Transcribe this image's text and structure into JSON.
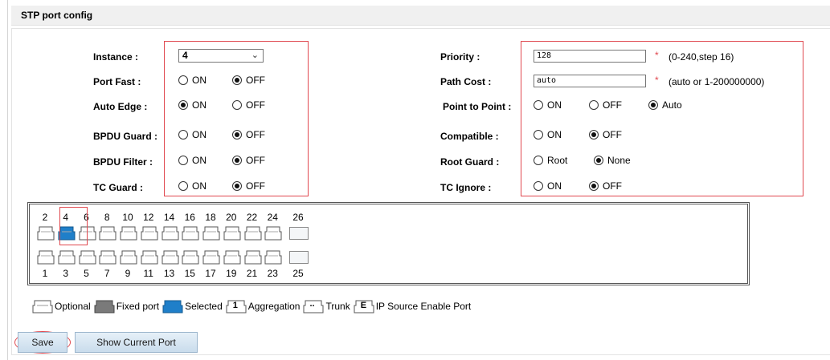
{
  "header": {
    "title": "STP port config"
  },
  "left": {
    "instance": {
      "label": "Instance :",
      "value": "4"
    },
    "port_fast": {
      "label": "Port Fast :",
      "on": "ON",
      "off": "OFF",
      "selected": "OFF"
    },
    "auto_edge": {
      "label": "Auto Edge :",
      "on": "ON",
      "off": "OFF",
      "selected": "ON"
    },
    "bpdu_guard": {
      "label": "BPDU Guard :",
      "on": "ON",
      "off": "OFF",
      "selected": "OFF"
    },
    "bpdu_filter": {
      "label": "BPDU Filter :",
      "on": "ON",
      "off": "OFF",
      "selected": "OFF"
    },
    "tc_guard": {
      "label": "TC Guard :",
      "on": "ON",
      "off": "OFF",
      "selected": "OFF"
    }
  },
  "right": {
    "priority": {
      "label": "Priority :",
      "value": "128",
      "required": "*",
      "hint": "(0-240,step 16)"
    },
    "path_cost": {
      "label": "Path Cost :",
      "value": "auto",
      "required": "*",
      "hint": "(auto or 1-200000000)"
    },
    "point_to_point": {
      "label": "Point to Point :",
      "on": "ON",
      "off": "OFF",
      "auto": "Auto",
      "selected": "Auto"
    },
    "compatible": {
      "label": "Compatible :",
      "on": "ON",
      "off": "OFF",
      "selected": "OFF"
    },
    "root_guard": {
      "label": "Root Guard :",
      "root": "Root",
      "none": "None",
      "selected": "None"
    },
    "tc_ignore": {
      "label": "TC Ignore :",
      "on": "ON",
      "off": "OFF",
      "selected": "OFF"
    }
  },
  "ports": {
    "top_labels": [
      "2",
      "4",
      "6",
      "8",
      "10",
      "12",
      "14",
      "16",
      "18",
      "20",
      "22",
      "24",
      "26"
    ],
    "bottom_labels": [
      "1",
      "3",
      "5",
      "7",
      "9",
      "11",
      "13",
      "15",
      "17",
      "19",
      "21",
      "23",
      "25"
    ],
    "selected_port": "4"
  },
  "legend": {
    "optional": "Optional",
    "fixed_port": "Fixed port",
    "selected": "Selected",
    "aggregation": "Aggregation",
    "aggregation_glyph": "1",
    "trunk": "Trunk",
    "trunk_glyph": "..",
    "ip_source": "IP Source Enable Port",
    "ip_source_glyph": "E"
  },
  "buttons": {
    "save": "Save",
    "show_current_port": "Show Current Port"
  },
  "colors": {
    "accent_red": "#e0484f",
    "selected_port": "#1f7fc9",
    "header_bg": "#f0f0f0"
  }
}
